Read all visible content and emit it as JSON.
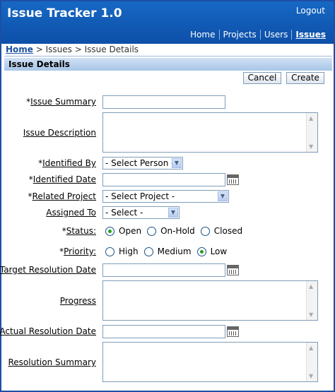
{
  "app": {
    "title": "Issue Tracker 1.0",
    "logout": "Logout"
  },
  "nav": {
    "home": "Home",
    "projects": "Projects",
    "users": "Users",
    "issues": "Issues"
  },
  "breadcrumb": {
    "home": "Home",
    "sep1": " > ",
    "issues": "Issues",
    "sep2": " > ",
    "current": "Issue Details"
  },
  "region": {
    "title": "Issue Details"
  },
  "buttons": {
    "cancel": "Cancel",
    "create": "Create"
  },
  "fields": {
    "issue_summary": {
      "req": "*",
      "label": "Issue Summary",
      "value": ""
    },
    "issue_description": {
      "label": "Issue Description",
      "value": ""
    },
    "identified_by": {
      "req": "*",
      "label": "Identified By",
      "value": "- Select Person -"
    },
    "identified_date": {
      "req": "*",
      "label": "Identified Date",
      "value": ""
    },
    "related_project": {
      "req": "*",
      "label": "Related Project",
      "value": "- Select Project -"
    },
    "assigned_to": {
      "label": "Assigned To",
      "value": "- Select -"
    },
    "status": {
      "req": "*",
      "label": "Status:",
      "options": [
        "Open",
        "On-Hold",
        "Closed"
      ],
      "selected": "Open"
    },
    "priority": {
      "req": "*",
      "label": "Priority:",
      "options": [
        "High",
        "Medium",
        "Low"
      ],
      "selected": "Low"
    },
    "target_resolution_date": {
      "label": "Target Resolution Date",
      "value": ""
    },
    "progress": {
      "label": "Progress",
      "value": ""
    },
    "actual_resolution_date": {
      "label": "Actual Resolution Date",
      "value": ""
    },
    "resolution_summary": {
      "label": "Resolution Summary",
      "value": ""
    }
  },
  "colors": {
    "header": "#1668c4",
    "region": "#a9c6e8",
    "radio_selected": "#21a121"
  }
}
